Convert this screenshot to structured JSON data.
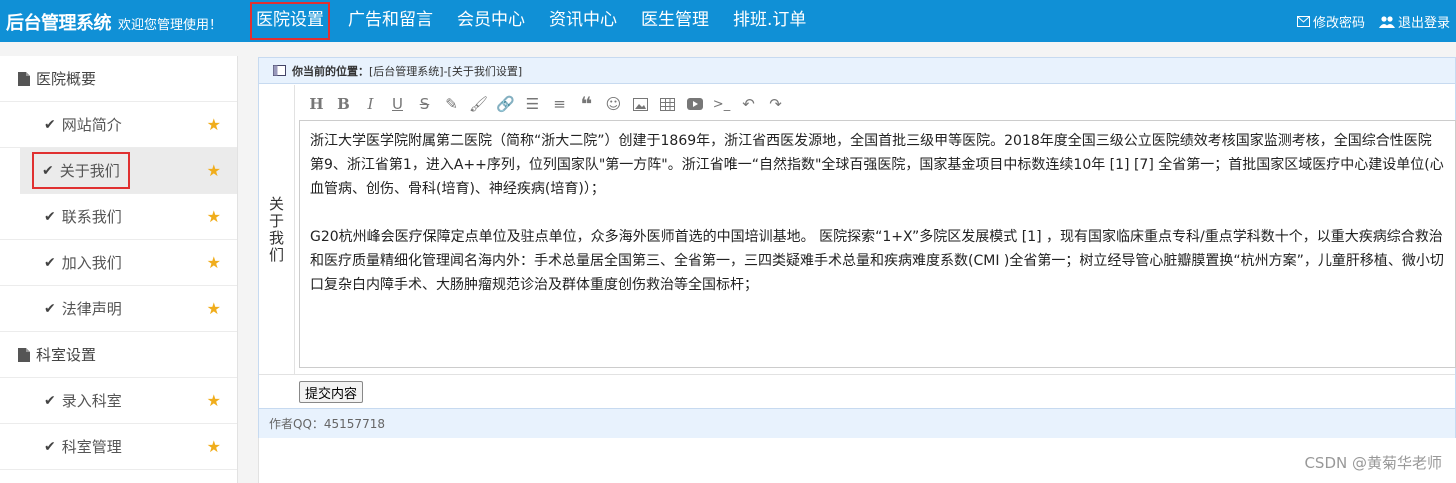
{
  "header": {
    "brand": "后台管理系统",
    "welcome": "欢迎您管理使用！",
    "nav": [
      "医院设置",
      "广告和留言",
      "会员中心",
      "资讯中心",
      "医生管理",
      "排班.订单"
    ],
    "change_password": "修改密码",
    "logout": "退出登录"
  },
  "sidebar": {
    "groups": [
      {
        "title": "医院概要",
        "items": [
          "网站简介",
          "关于我们",
          "联系我们",
          "加入我们",
          "法律声明"
        ]
      },
      {
        "title": "科室设置",
        "items": [
          "录入科室",
          "科室管理"
        ]
      }
    ]
  },
  "panel": {
    "location_label": "你当前的位置：",
    "location_path": "[后台管理系统]-[关于我们设置]",
    "field_label": "关于我们",
    "editor_paragraphs": [
      "浙江大学医学院附属第二医院（简称“浙大二院”）创建于1869年，浙江省西医发源地，全国首批三级甲等医院。2018年度全国三级公立医院绩效考核国家监测考核，全国综合性医院第9、浙江省第1，进入A++序列，位列国家队\"第一方阵\"。浙江省唯一“自然指数\"全球百强医院，国家基金项目中标数连续10年 [1] [7] 全省第一；首批国家区域医疗中心建设单位(心血管病、创伤、骨科(培育)、神经疾病(培育)）；",
      "G20杭州峰会医疗保障定点单位及驻点单位，众多海外医师首选的中国培训基地。 医院探索“1+X”多院区发展模式 [1] ，现有国家临床重点专科/重点学科数十个，以重大疾病综合救治和医疗质量精细化管理闻名海内外：手术总量居全国第三、全省第一，三四类疑难手术总量和疾病难度系数(CMI )全省第一；树立经导管心脏瓣膜置换“杭州方案”，儿童肝移植、微小切口复杂白内障手术、大肠肿瘤规范诊治及群体重度创伤救治等全国标杆；"
    ],
    "submit": "提交内容",
    "footer": "作者QQ：45157718"
  },
  "watermark": "CSDN @黄菊华老师",
  "colors": {
    "topbar": "#1090d6",
    "highlight": "#e03030",
    "star": "#f0ad1c"
  }
}
